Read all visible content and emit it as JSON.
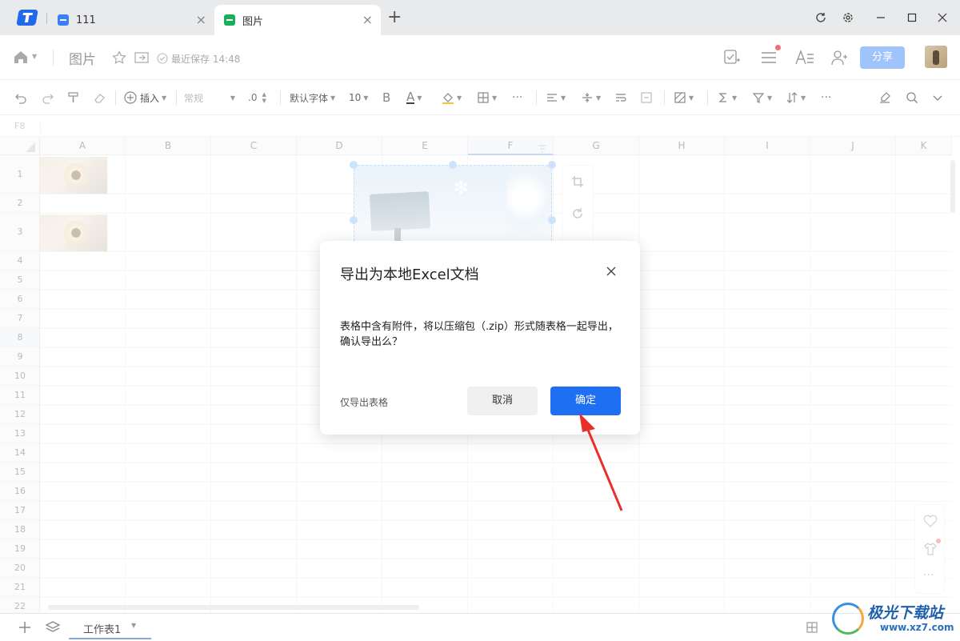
{
  "tabs": [
    {
      "label": "111",
      "icon": "doc-icon",
      "color": "#3a7ff5"
    },
    {
      "label": "图片",
      "icon": "sheet-icon",
      "color": "#1aad5b"
    }
  ],
  "new_tab_symbol": "+",
  "header": {
    "title": "图片",
    "save_status": "最近保存 14:48",
    "share_label": "分享",
    "accent": "#6aa6f8"
  },
  "toolbar": {
    "insert": "插入",
    "format": "常规",
    "decimal": ".0",
    "font": "默认字体",
    "font_size": "10",
    "bold": "B",
    "font_color_letter": "A"
  },
  "cell_ref": "F8",
  "columns": [
    "A",
    "B",
    "C",
    "D",
    "E",
    "F",
    "G",
    "H",
    "I",
    "J",
    "K"
  ],
  "rows": [
    "1",
    "2",
    "3",
    "4",
    "5",
    "6",
    "7",
    "8",
    "9",
    "10",
    "11",
    "12",
    "13",
    "14",
    "15",
    "16",
    "17",
    "18",
    "19",
    "20",
    "21",
    "22"
  ],
  "dialog": {
    "title": "导出为本地Excel文档",
    "message": "表格中含有附件，将以压缩包（.zip）形式随表格一起导出，确认导出么？",
    "secondary_link": "仅导出表格",
    "cancel_label": "取消",
    "confirm_label": "确定",
    "confirm_color": "#1f6ff2"
  },
  "sheet_tab": "工作表1",
  "watermark": {
    "text": "极光下载站",
    "url": "www.xz7.com"
  }
}
